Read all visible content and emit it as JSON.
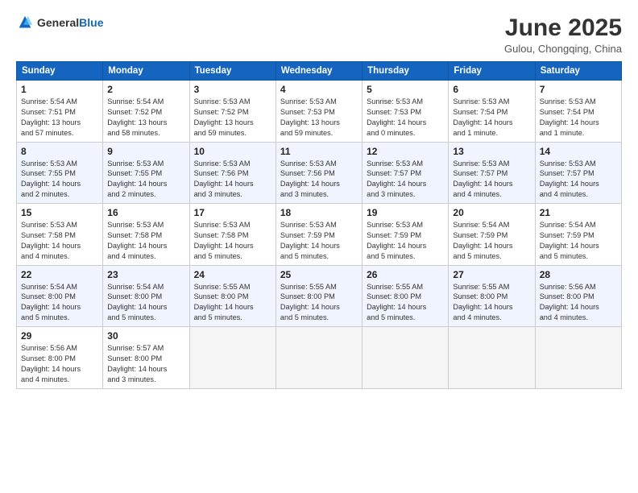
{
  "header": {
    "logo_general": "General",
    "logo_blue": "Blue",
    "title": "June 2025",
    "subtitle": "Gulou, Chongqing, China"
  },
  "calendar": {
    "days_of_week": [
      "Sunday",
      "Monday",
      "Tuesday",
      "Wednesday",
      "Thursday",
      "Friday",
      "Saturday"
    ],
    "rows": [
      [
        {
          "day": "1",
          "info": "Sunrise: 5:54 AM\nSunset: 7:51 PM\nDaylight: 13 hours\nand 57 minutes."
        },
        {
          "day": "2",
          "info": "Sunrise: 5:54 AM\nSunset: 7:52 PM\nDaylight: 13 hours\nand 58 minutes."
        },
        {
          "day": "3",
          "info": "Sunrise: 5:53 AM\nSunset: 7:52 PM\nDaylight: 13 hours\nand 59 minutes."
        },
        {
          "day": "4",
          "info": "Sunrise: 5:53 AM\nSunset: 7:53 PM\nDaylight: 13 hours\nand 59 minutes."
        },
        {
          "day": "5",
          "info": "Sunrise: 5:53 AM\nSunset: 7:53 PM\nDaylight: 14 hours\nand 0 minutes."
        },
        {
          "day": "6",
          "info": "Sunrise: 5:53 AM\nSunset: 7:54 PM\nDaylight: 14 hours\nand 1 minute."
        },
        {
          "day": "7",
          "info": "Sunrise: 5:53 AM\nSunset: 7:54 PM\nDaylight: 14 hours\nand 1 minute."
        }
      ],
      [
        {
          "day": "8",
          "info": "Sunrise: 5:53 AM\nSunset: 7:55 PM\nDaylight: 14 hours\nand 2 minutes."
        },
        {
          "day": "9",
          "info": "Sunrise: 5:53 AM\nSunset: 7:55 PM\nDaylight: 14 hours\nand 2 minutes."
        },
        {
          "day": "10",
          "info": "Sunrise: 5:53 AM\nSunset: 7:56 PM\nDaylight: 14 hours\nand 3 minutes."
        },
        {
          "day": "11",
          "info": "Sunrise: 5:53 AM\nSunset: 7:56 PM\nDaylight: 14 hours\nand 3 minutes."
        },
        {
          "day": "12",
          "info": "Sunrise: 5:53 AM\nSunset: 7:57 PM\nDaylight: 14 hours\nand 3 minutes."
        },
        {
          "day": "13",
          "info": "Sunrise: 5:53 AM\nSunset: 7:57 PM\nDaylight: 14 hours\nand 4 minutes."
        },
        {
          "day": "14",
          "info": "Sunrise: 5:53 AM\nSunset: 7:57 PM\nDaylight: 14 hours\nand 4 minutes."
        }
      ],
      [
        {
          "day": "15",
          "info": "Sunrise: 5:53 AM\nSunset: 7:58 PM\nDaylight: 14 hours\nand 4 minutes."
        },
        {
          "day": "16",
          "info": "Sunrise: 5:53 AM\nSunset: 7:58 PM\nDaylight: 14 hours\nand 4 minutes."
        },
        {
          "day": "17",
          "info": "Sunrise: 5:53 AM\nSunset: 7:58 PM\nDaylight: 14 hours\nand 5 minutes."
        },
        {
          "day": "18",
          "info": "Sunrise: 5:53 AM\nSunset: 7:59 PM\nDaylight: 14 hours\nand 5 minutes."
        },
        {
          "day": "19",
          "info": "Sunrise: 5:53 AM\nSunset: 7:59 PM\nDaylight: 14 hours\nand 5 minutes."
        },
        {
          "day": "20",
          "info": "Sunrise: 5:54 AM\nSunset: 7:59 PM\nDaylight: 14 hours\nand 5 minutes."
        },
        {
          "day": "21",
          "info": "Sunrise: 5:54 AM\nSunset: 7:59 PM\nDaylight: 14 hours\nand 5 minutes."
        }
      ],
      [
        {
          "day": "22",
          "info": "Sunrise: 5:54 AM\nSunset: 8:00 PM\nDaylight: 14 hours\nand 5 minutes."
        },
        {
          "day": "23",
          "info": "Sunrise: 5:54 AM\nSunset: 8:00 PM\nDaylight: 14 hours\nand 5 minutes."
        },
        {
          "day": "24",
          "info": "Sunrise: 5:55 AM\nSunset: 8:00 PM\nDaylight: 14 hours\nand 5 minutes."
        },
        {
          "day": "25",
          "info": "Sunrise: 5:55 AM\nSunset: 8:00 PM\nDaylight: 14 hours\nand 5 minutes."
        },
        {
          "day": "26",
          "info": "Sunrise: 5:55 AM\nSunset: 8:00 PM\nDaylight: 14 hours\nand 5 minutes."
        },
        {
          "day": "27",
          "info": "Sunrise: 5:55 AM\nSunset: 8:00 PM\nDaylight: 14 hours\nand 4 minutes."
        },
        {
          "day": "28",
          "info": "Sunrise: 5:56 AM\nSunset: 8:00 PM\nDaylight: 14 hours\nand 4 minutes."
        }
      ],
      [
        {
          "day": "29",
          "info": "Sunrise: 5:56 AM\nSunset: 8:00 PM\nDaylight: 14 hours\nand 4 minutes."
        },
        {
          "day": "30",
          "info": "Sunrise: 5:57 AM\nSunset: 8:00 PM\nDaylight: 14 hours\nand 3 minutes."
        },
        {
          "day": "",
          "info": ""
        },
        {
          "day": "",
          "info": ""
        },
        {
          "day": "",
          "info": ""
        },
        {
          "day": "",
          "info": ""
        },
        {
          "day": "",
          "info": ""
        }
      ]
    ]
  }
}
